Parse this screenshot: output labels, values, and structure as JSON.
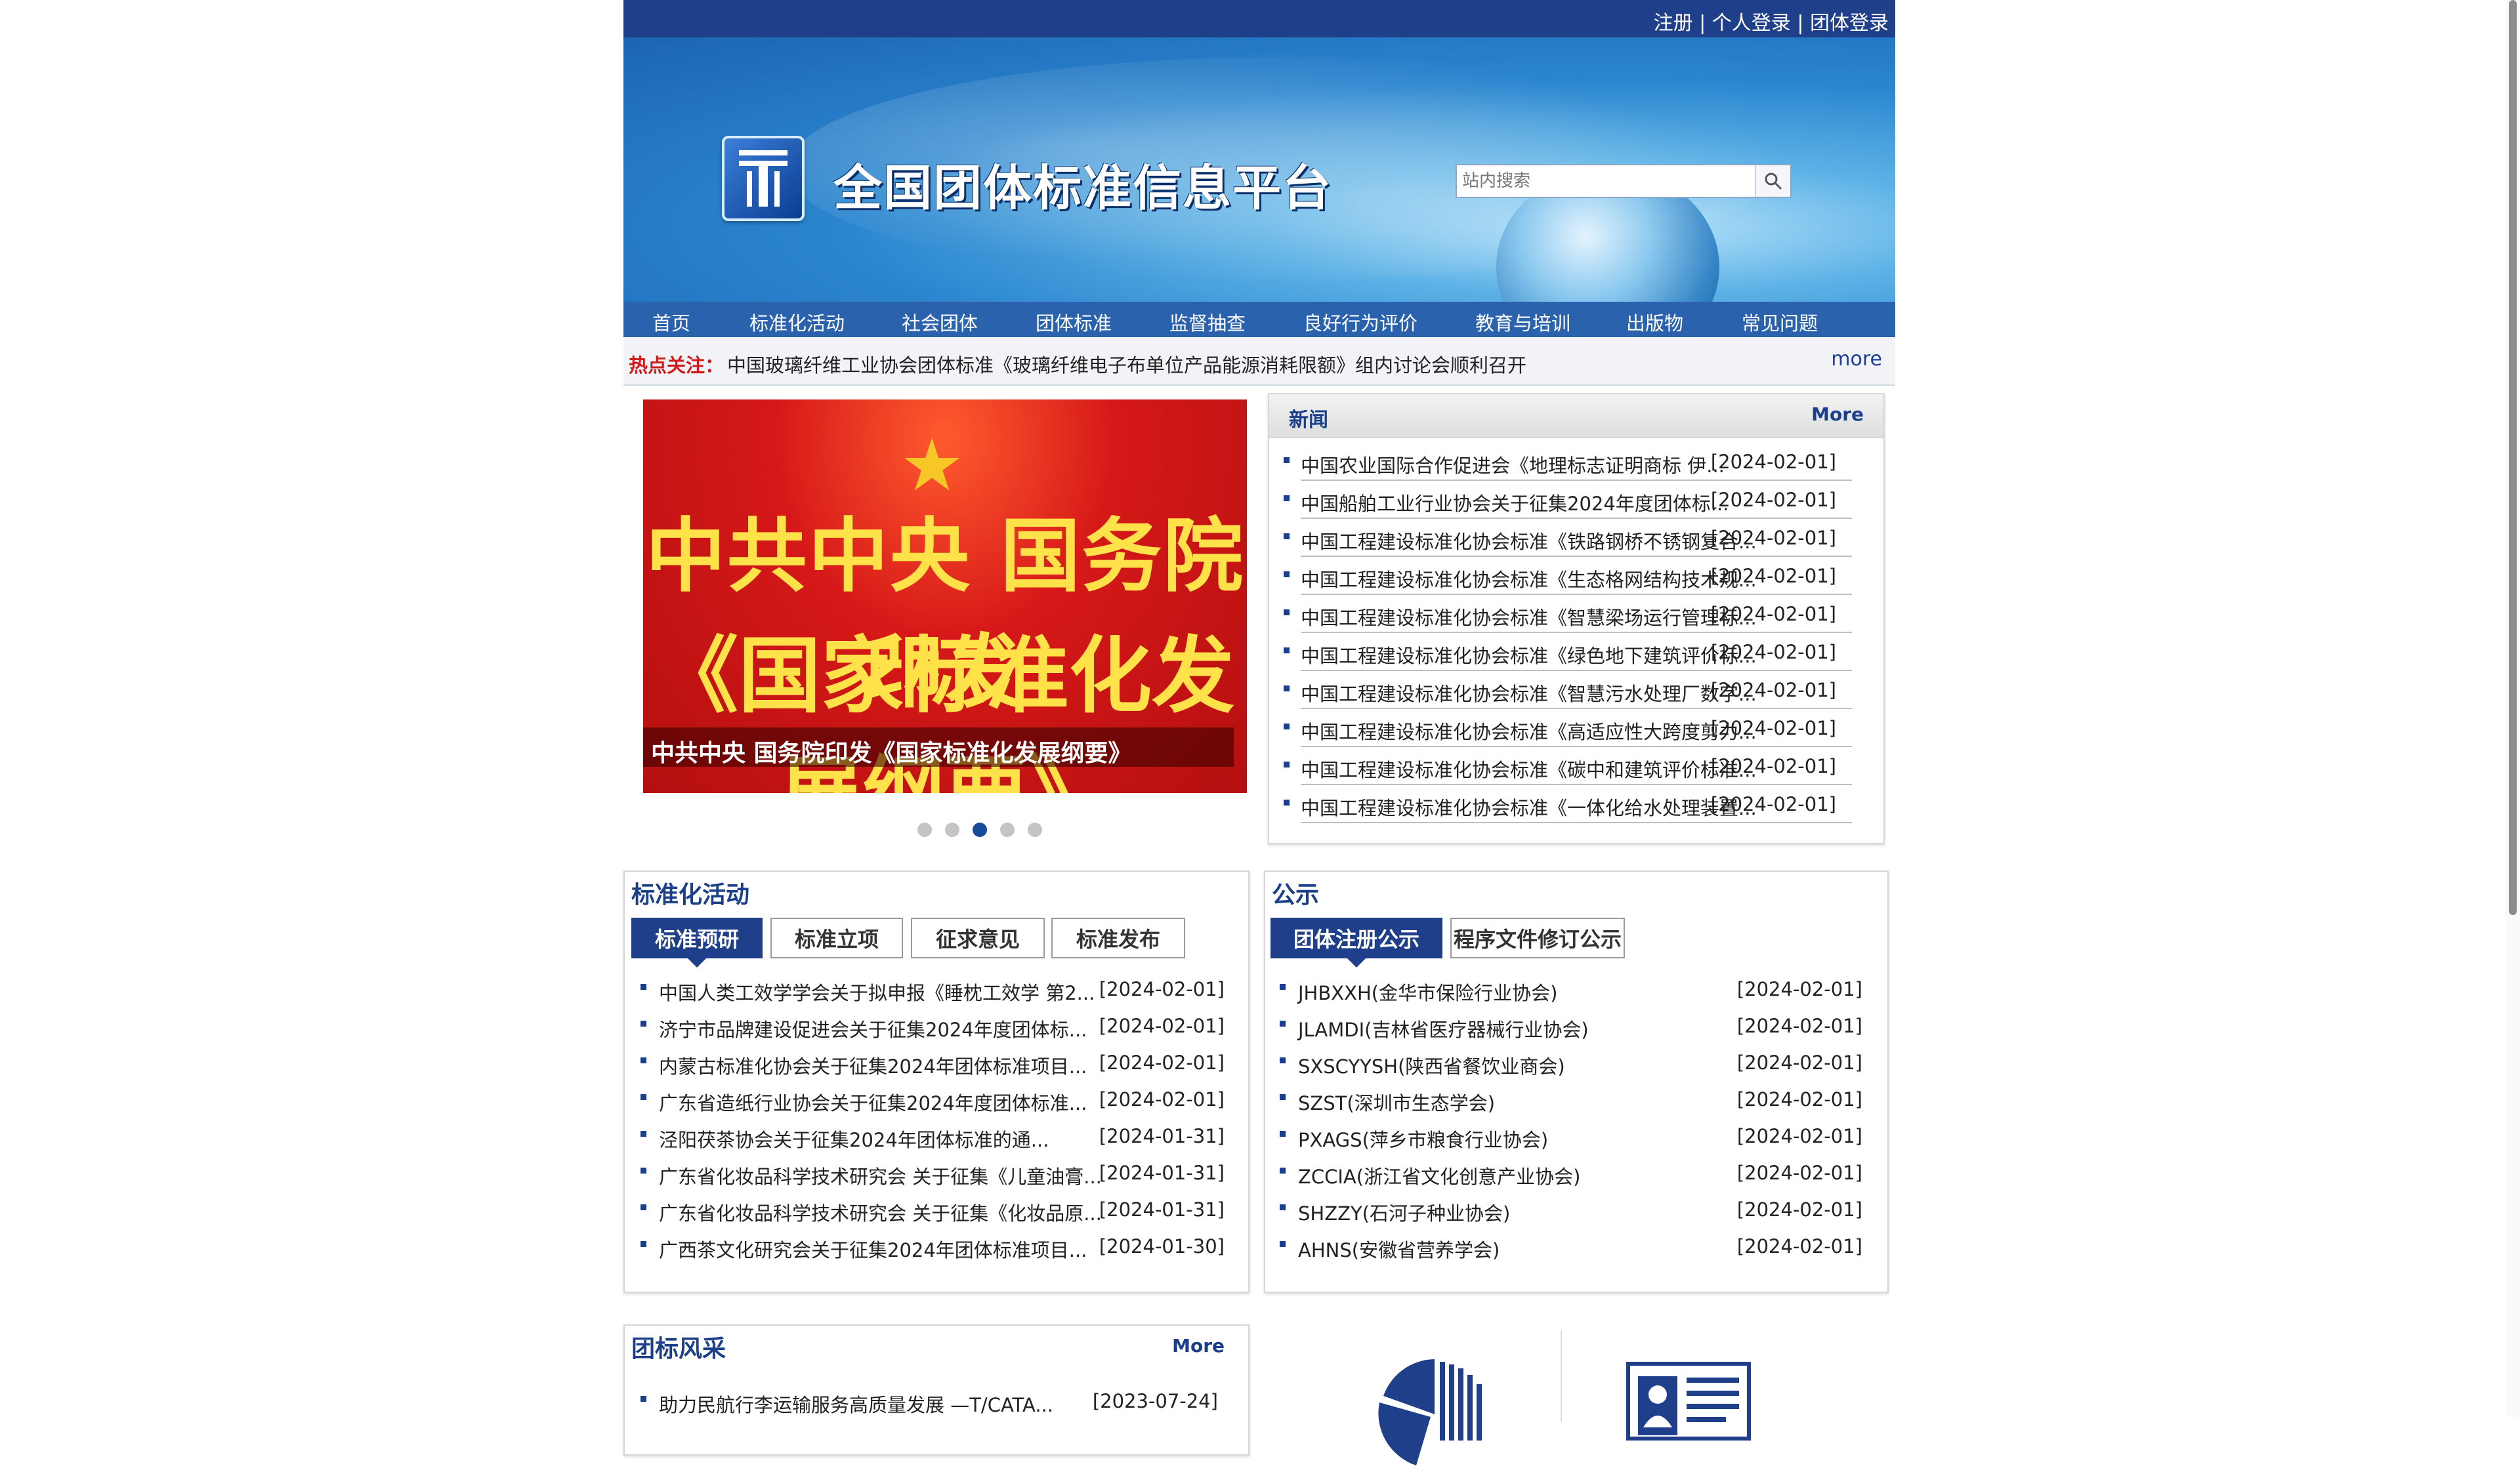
{
  "topbar": {
    "register": "注册",
    "sep": "|",
    "personal_login": "个人登录",
    "group_login": "团体登录"
  },
  "banner": {
    "site_title": "全国团体标准信息平台"
  },
  "search": {
    "placeholder": "站内搜索"
  },
  "nav": {
    "items": [
      "首页",
      "标准化活动",
      "社会团体",
      "团体标准",
      "监督抽查",
      "良好行为评价",
      "教育与培训",
      "出版物",
      "常见问题"
    ]
  },
  "hot": {
    "label": "热点关注：",
    "text": "中国玻璃纤维工业协会团体标准《玻璃纤维电子布单位产品能源消耗限额》组内讨论会顺利召开",
    "more": "more"
  },
  "carousel": {
    "headline_line1": "中共中央 国务院印发",
    "headline_line2": "《国家标准化发展纲要》",
    "caption": "中共中央 国务院印发《国家标准化发展纲要》",
    "active_index": 2,
    "count": 5
  },
  "news": {
    "title": "新闻",
    "more": "More",
    "items": [
      {
        "title": "中国农业国际合作促进会《地理标志证明商标 伊...",
        "date": "[2024-02-01]"
      },
      {
        "title": "中国船舶工业行业协会关于征集2024年度团体标...",
        "date": "[2024-02-01]"
      },
      {
        "title": "中国工程建设标准化协会标准《铁路钢桥不锈钢复合...",
        "date": "[2024-02-01]"
      },
      {
        "title": "中国工程建设标准化协会标准《生态格网结构技术规...",
        "date": "[2024-02-01]"
      },
      {
        "title": "中国工程建设标准化协会标准《智慧梁场运行管理标...",
        "date": "[2024-02-01]"
      },
      {
        "title": "中国工程建设标准化协会标准《绿色地下建筑评价标...",
        "date": "[2024-02-01]"
      },
      {
        "title": "中国工程建设标准化协会标准《智慧污水处理厂数字...",
        "date": "[2024-02-01]"
      },
      {
        "title": "中国工程建设标准化协会标准《高适应性大跨度剪力...",
        "date": "[2024-02-01]"
      },
      {
        "title": "中国工程建设标准化协会标准《碳中和建筑评价标准...",
        "date": "[2024-02-01]"
      },
      {
        "title": "中国工程建设标准化协会标准《一体化给水处理装置...",
        "date": "[2024-02-01]"
      }
    ]
  },
  "activities": {
    "title": "标准化活动",
    "tabs": [
      "标准预研",
      "标准立项",
      "征求意见",
      "标准发布"
    ],
    "active_tab": 0,
    "items": [
      {
        "title": "中国人类工效学学会关于拟申报《睡枕工效学 第2...",
        "date": "[2024-02-01]"
      },
      {
        "title": "济宁市品牌建设促进会关于征集2024年度团体标...",
        "date": "[2024-02-01]"
      },
      {
        "title": "内蒙古标准化协会关于征集2024年团体标准项目...",
        "date": "[2024-02-01]"
      },
      {
        "title": "广东省造纸行业协会关于征集2024年度团体标准...",
        "date": "[2024-02-01]"
      },
      {
        "title": "泾阳茯茶协会关于征集2024年团体标准的通...",
        "date": "[2024-01-31]"
      },
      {
        "title": "广东省化妆品科学技术研究会 关于征集《儿童油膏...",
        "date": "[2024-01-31]"
      },
      {
        "title": "广东省化妆品科学技术研究会 关于征集《化妆品原...",
        "date": "[2024-01-31]"
      },
      {
        "title": "广西茶文化研究会关于征集2024年团体标准项目...",
        "date": "[2024-01-30]"
      }
    ]
  },
  "public_notice": {
    "title": "公示",
    "tabs": [
      "团体注册公示",
      "程序文件修订公示"
    ],
    "active_tab": 0,
    "items": [
      {
        "title": "JHBXXH(金华市保险行业协会)",
        "date": "[2024-02-01]"
      },
      {
        "title": "JLAMDI(吉林省医疗器械行业协会)",
        "date": "[2024-02-01]"
      },
      {
        "title": "SXSCYYSH(陕西省餐饮业商会)",
        "date": "[2024-02-01]"
      },
      {
        "title": "SZST(深圳市生态学会)",
        "date": "[2024-02-01]"
      },
      {
        "title": "PXAGS(萍乡市粮食行业协会)",
        "date": "[2024-02-01]"
      },
      {
        "title": "ZCCIA(浙江省文化创意产业协会)",
        "date": "[2024-02-01]"
      },
      {
        "title": "SHZZY(石河子种业协会)",
        "date": "[2024-02-01]"
      },
      {
        "title": "AHNS(安徽省营养学会)",
        "date": "[2024-02-01]"
      }
    ]
  },
  "style_section": {
    "title": "团标风采",
    "more": "More",
    "items": [
      {
        "title": "助力民航行李运输服务高质量发展 —T/CATA...",
        "date": "[2023-07-24]"
      }
    ]
  },
  "colors": {
    "primary": "#1f3f8a",
    "nav": "#2a62ae",
    "hot_label": "#d11a1a",
    "slide_text": "#ffe14a"
  },
  "icons": [
    "search-icon",
    "pie-chart-icon",
    "id-card-icon"
  ]
}
